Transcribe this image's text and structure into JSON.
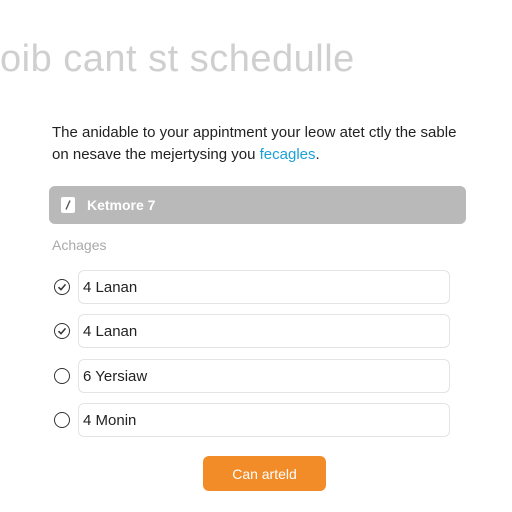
{
  "header": {
    "title": "oib cant st schedulle"
  },
  "intro": {
    "text": "The anidable to your appintment your leow atet ctly the sable on nesave the mejertysing you ",
    "link_text": "fecagles",
    "trailing": "."
  },
  "selected": {
    "label": "Ketmore 7",
    "icon": "edit-icon"
  },
  "section": {
    "label": "Achages"
  },
  "options": [
    {
      "label": "4 Lanan",
      "checked": true
    },
    {
      "label": "4 Lanan",
      "checked": true
    },
    {
      "label": "6 Yersiaw",
      "checked": false
    },
    {
      "label": "4 Monin",
      "checked": false
    }
  ],
  "cta": {
    "label": "Can arteld",
    "color": "#f28c28"
  }
}
